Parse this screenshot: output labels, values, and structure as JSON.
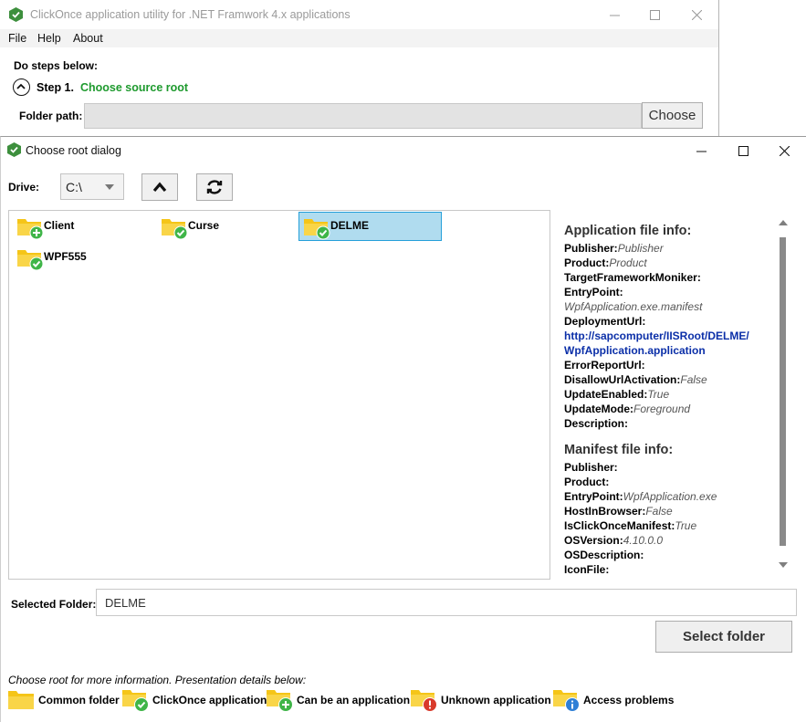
{
  "main_window": {
    "title": "ClickOnce application utility for .NET Framwork 4.x applications",
    "menu": [
      "File",
      "Help",
      "About"
    ],
    "steps_label": "Do steps below:",
    "step": {
      "number": "Step 1.",
      "title": "Choose source root"
    },
    "folder_path_label": "Folder path:",
    "folder_path_value": "",
    "choose_button": "Choose"
  },
  "dialog": {
    "title": "Choose root dialog",
    "drive_label": "Drive:",
    "drive_value": "C:\\",
    "folders": [
      {
        "name": "Client",
        "badge": "plus",
        "selected": false
      },
      {
        "name": "Curse",
        "badge": "check",
        "selected": false
      },
      {
        "name": "DELME",
        "badge": "check",
        "selected": true
      },
      {
        "name": "WPF555",
        "badge": "check",
        "selected": false
      }
    ],
    "app_info": {
      "heading": "Application file info:",
      "publisher": {
        "key": "Publisher:",
        "value": "Publisher"
      },
      "product": {
        "key": "Product:",
        "value": "Product"
      },
      "target": {
        "key": "TargetFrameworkMoniker:",
        "value": ""
      },
      "entry": {
        "key": "EntryPoint:",
        "value": "WpfApplication.exe.manifest"
      },
      "deploy": {
        "key": "DeploymentUrl:",
        "line1": "http://sapcomputer/IISRoot/DELME/",
        "line2": "WpfApplication.application"
      },
      "error": {
        "key": "ErrorReportUrl:",
        "value": ""
      },
      "disallow": {
        "key": "DisallowUrlActivation:",
        "value": "False"
      },
      "update_enabled": {
        "key": "UpdateEnabled:",
        "value": "True"
      },
      "update_mode": {
        "key": "UpdateMode:",
        "value": "Foreground"
      },
      "description": {
        "key": "Description:",
        "value": ""
      }
    },
    "manifest_info": {
      "heading": "Manifest file info:",
      "publisher": {
        "key": "Publisher:",
        "value": ""
      },
      "product": {
        "key": "Product:",
        "value": ""
      },
      "entry": {
        "key": "EntryPoint:",
        "value": "WpfApplication.exe"
      },
      "host": {
        "key": "HostInBrowser:",
        "value": "False"
      },
      "clickonce": {
        "key": "IsClickOnceManifest:",
        "value": "True"
      },
      "osversion": {
        "key": "OSVersion:",
        "value": "4.10.0.0"
      },
      "osdesc": {
        "key": "OSDescription:",
        "value": ""
      },
      "iconfile": {
        "key": "IconFile:",
        "value": ""
      }
    },
    "selected_folder_label": "Selected Folder:",
    "selected_folder_value": "DELME",
    "select_button": "Select folder",
    "legend_note": "Choose root for more information. Presentation details below:",
    "legend": [
      {
        "label": "Common folder",
        "badge": "none"
      },
      {
        "label": "ClickOnce application",
        "badge": "check"
      },
      {
        "label": "Can be an application",
        "badge": "plus"
      },
      {
        "label": "Unknown application",
        "badge": "error"
      },
      {
        "label": "Access problems",
        "badge": "info"
      }
    ]
  },
  "colors": {
    "step_green": "#1e9a2e",
    "link_blue": "#0b2fa8",
    "selection_fill": "#b0dcef",
    "selection_border": "#26a0da",
    "folder_yellow": "#f5c518"
  }
}
